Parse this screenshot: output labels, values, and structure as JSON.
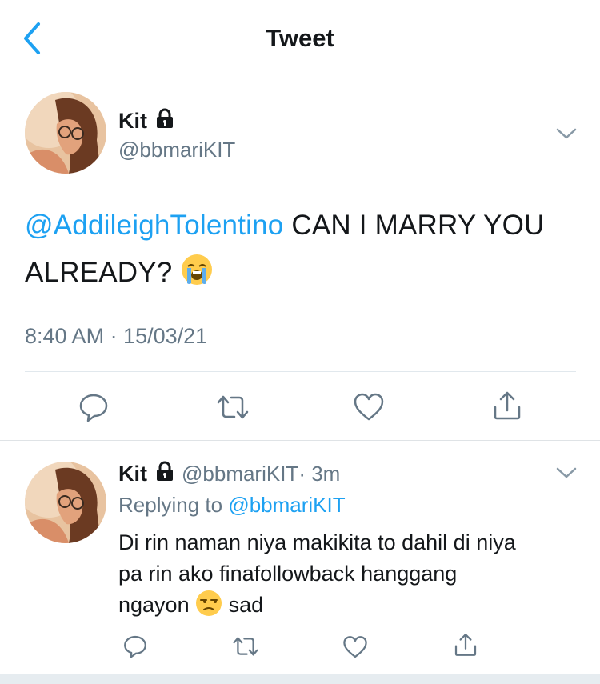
{
  "header": {
    "title": "Tweet"
  },
  "main_tweet": {
    "name": "Kit",
    "handle": "@bbmariKIT",
    "mention": "@AddileighTolentino",
    "text": " CAN I MARRY YOU ALREADY? ",
    "emoji": "loudly-crying-face",
    "timestamp": "8:40 AM · 15/03/21"
  },
  "reply": {
    "name": "Kit",
    "handle": "@bbmariKIT",
    "time": " · 3m",
    "replying_prefix": "Replying to ",
    "replying_handle": "@bbmariKIT",
    "text_line1": "Di rin naman niya makikita to dahil di niya",
    "text_line2": "pa rin ako finafollowback hanggang",
    "text_line3a": "ngayon ",
    "text_line3b": " sad",
    "emoji": "unamused-face"
  },
  "colors": {
    "accent": "#1da1f2",
    "text": "#14171a",
    "muted": "#657786",
    "divider": "#e1e8ed"
  },
  "icons": [
    "back-chevron-icon",
    "lock-icon",
    "chevron-down-icon",
    "reply-icon",
    "retweet-icon",
    "like-icon",
    "share-icon"
  ]
}
